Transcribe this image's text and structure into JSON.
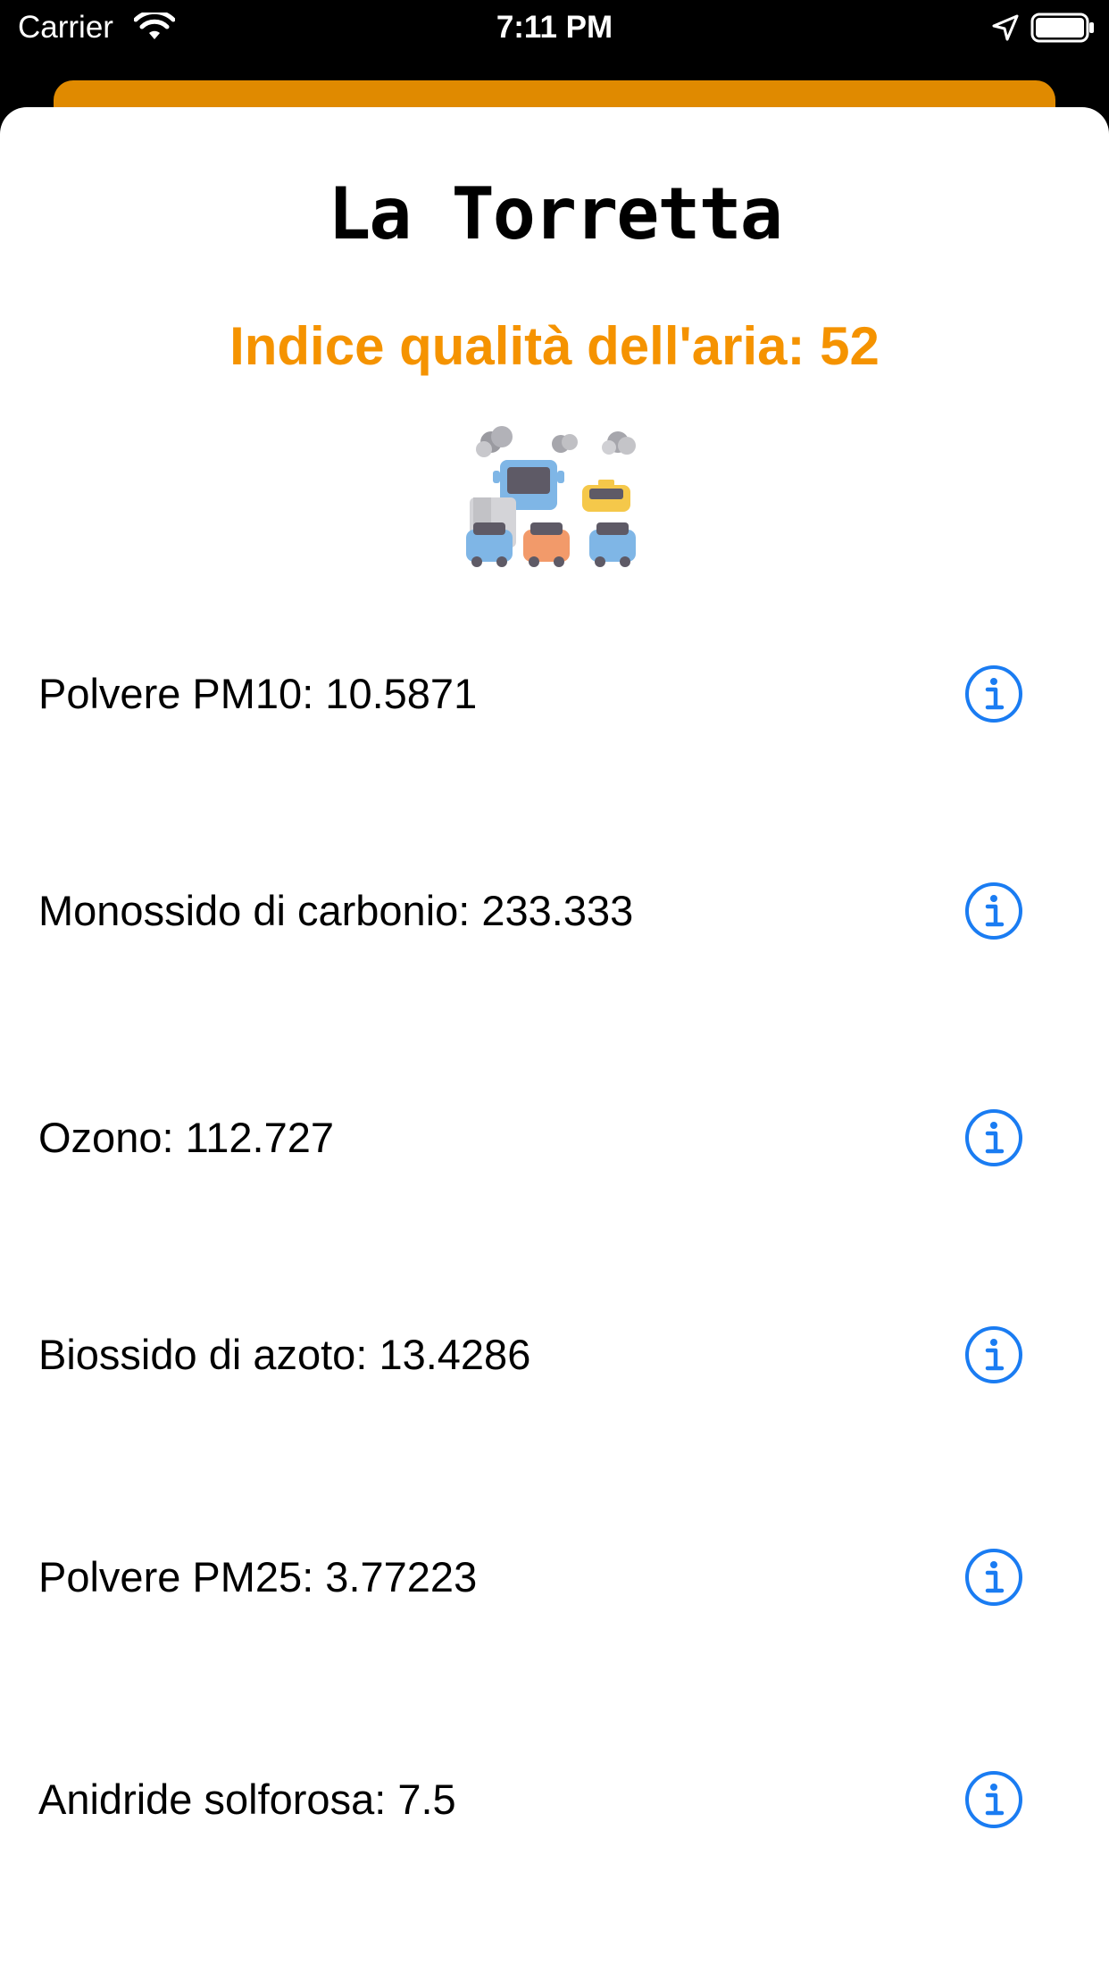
{
  "status_bar": {
    "carrier": "Carrier",
    "time": "7:11 PM",
    "wifi_icon": "wifi-icon",
    "location_icon": "location-arrow-icon",
    "battery_icon": "battery-icon"
  },
  "header": {
    "title": "La Torretta",
    "aqi_label": "Indice qualità dell'aria: 52",
    "illustration": "traffic-pollution-icon"
  },
  "pollutants": [
    {
      "label": "Polvere PM10: 10.5871",
      "icon": "info-icon"
    },
    {
      "label": "Monossido di carbonio: 233.333",
      "icon": "info-icon"
    },
    {
      "label": "Ozono: 112.727",
      "icon": "info-icon"
    },
    {
      "label": "Biossido di azoto: 13.4286",
      "icon": "info-icon"
    },
    {
      "label": "Polvere PM25: 3.77223",
      "icon": "info-icon"
    },
    {
      "label": "Anidride solforosa: 7.5",
      "icon": "info-icon"
    }
  ],
  "colors": {
    "accent_orange": "#f59300",
    "back_card_orange": "#e08a00",
    "info_blue": "#1a7cf2",
    "status_bar_bg": "#000000"
  }
}
